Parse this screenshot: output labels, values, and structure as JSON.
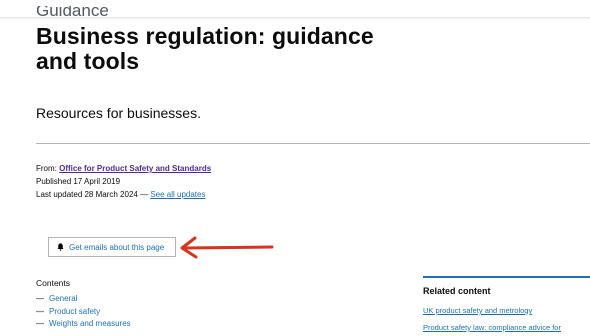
{
  "page": {
    "eyebrow": "Guidance",
    "title": "Business regulation: guidance and tools",
    "summary": "Resources for businesses."
  },
  "meta": {
    "from_label": "From:",
    "from_org": "Office for Product Safety and Standards",
    "published": "Published 17 April 2019",
    "updated_prefix": "Last updated 28 March 2024 —",
    "updates_link": "See all updates"
  },
  "email_button": {
    "label": "Get emails about this page",
    "icon": "bell-icon"
  },
  "annotation": {
    "arrow_color": "#d4351c"
  },
  "contents": {
    "heading": "Contents",
    "items": [
      "General",
      "Product safety",
      "Weights and measures"
    ]
  },
  "related": {
    "heading": "Related content",
    "links": [
      "UK product safety and metrology",
      "Product safety law: compliance advice for"
    ]
  },
  "colors": {
    "link": "#1d70b8",
    "visited": "#4c2c92",
    "text": "#0b0c0c",
    "secondary": "#505a5f"
  }
}
